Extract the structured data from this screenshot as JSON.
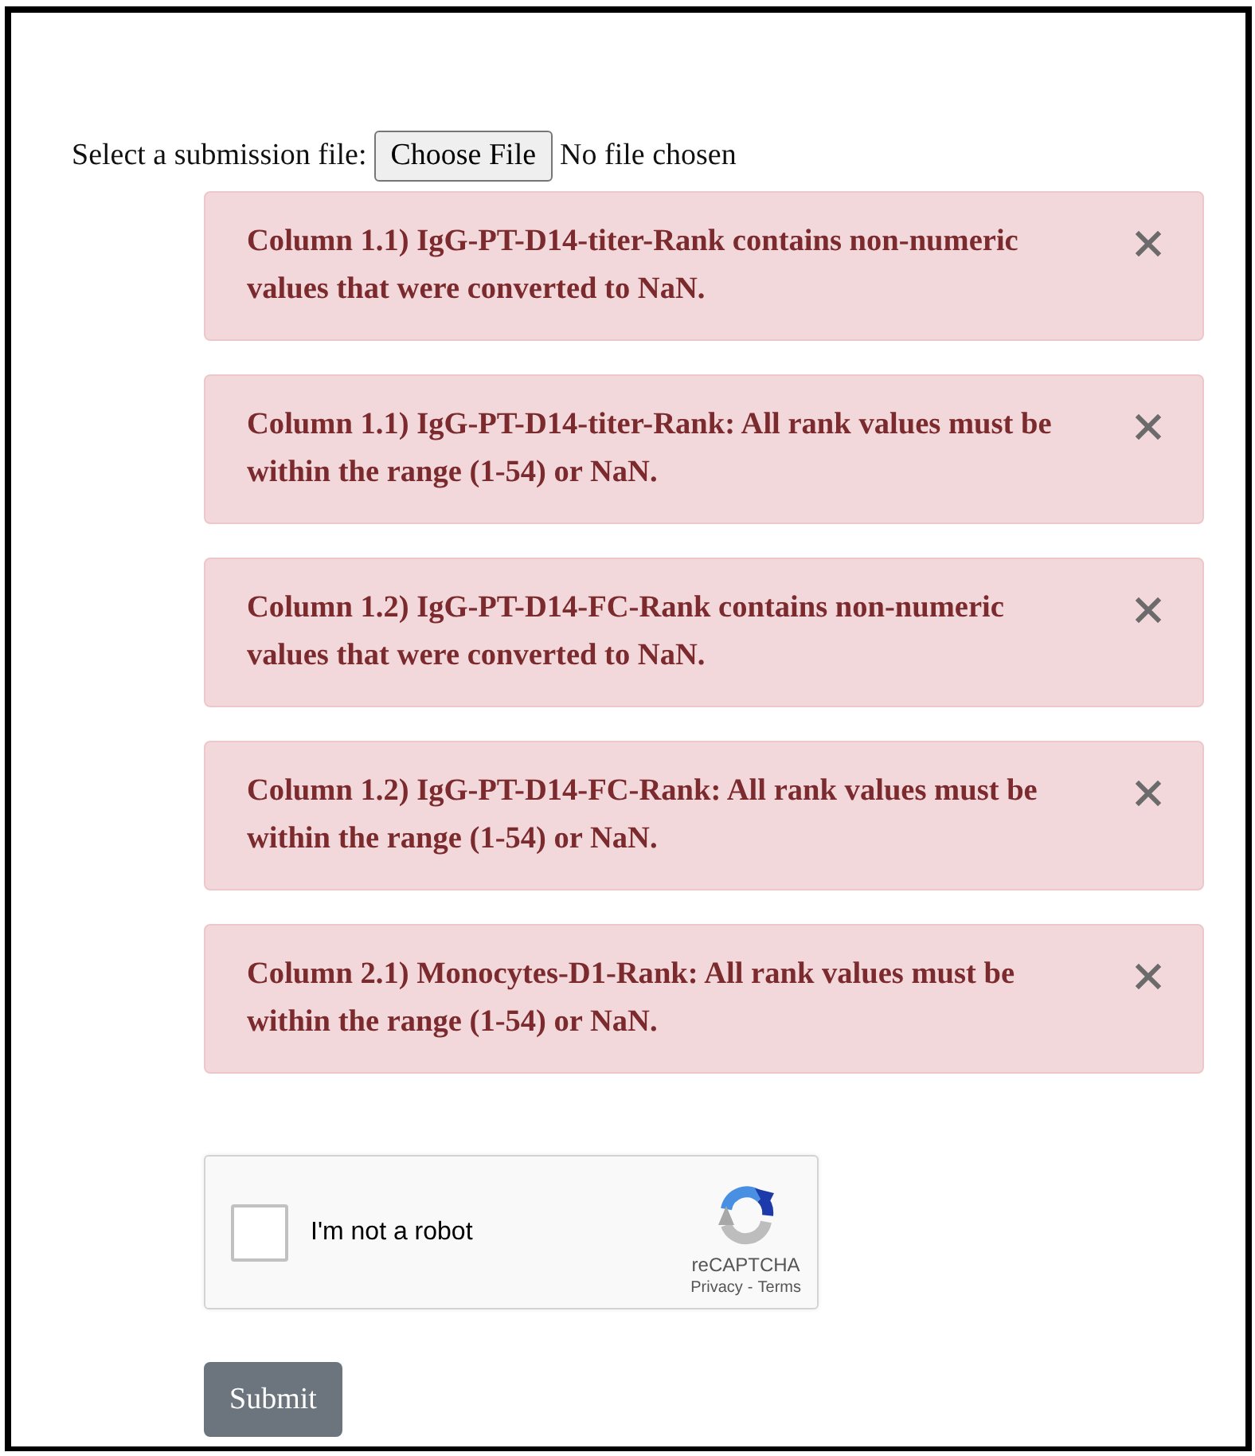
{
  "file_input": {
    "label": "Select a submission file:",
    "button": "Choose File",
    "status": "No file chosen"
  },
  "alerts": [
    {
      "text": "Column 1.1) IgG-PT-D14-titer-Rank contains non-numeric values that were converted to NaN."
    },
    {
      "text": "Column 1.1) IgG-PT-D14-titer-Rank: All rank values must be within the range (1-54) or NaN."
    },
    {
      "text": "Column 1.2) IgG-PT-D14-FC-Rank contains non-numeric values that were converted to NaN."
    },
    {
      "text": "Column 1.2) IgG-PT-D14-FC-Rank: All rank values must be within the range (1-54) or NaN."
    },
    {
      "text": "Column 2.1) Monocytes-D1-Rank: All rank values must be within the range (1-54) or NaN."
    }
  ],
  "captcha": {
    "label": "I'm not a robot",
    "checked": false,
    "brand": "reCAPTCHA",
    "links": [
      "Privacy",
      "Terms"
    ],
    "separator": "-"
  },
  "submit": "Submit"
}
